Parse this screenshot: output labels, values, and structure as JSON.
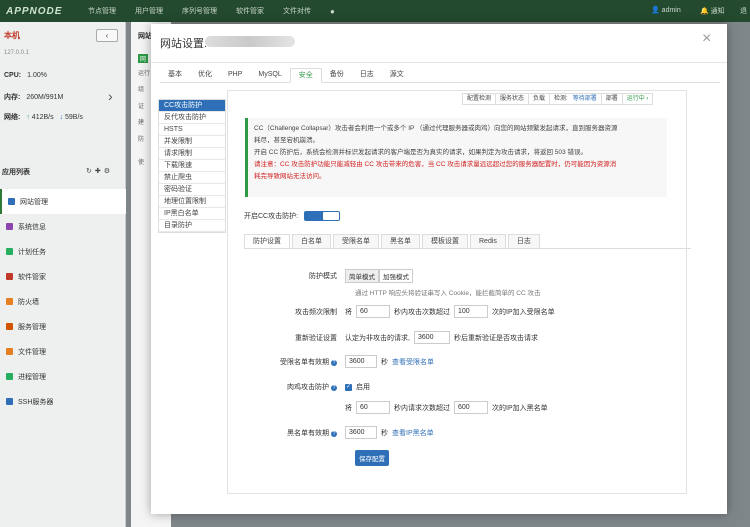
{
  "topnav": {
    "logo": "APPNODE",
    "items": [
      "节点管理",
      "用户管理",
      "序列号管理",
      "软件管家",
      "文件对传"
    ],
    "admin": "admin",
    "notify": "通知",
    "exit": "退"
  },
  "sidebar": {
    "host": "本机",
    "back": "‹",
    "ip": "127.0.0.1",
    "cpu_label": "CPU:",
    "cpu_value": "1.00%",
    "mem_label": "内存:",
    "mem_value": "260M/991M",
    "net_label": "网络:",
    "net_up": "412B/s",
    "net_down": "59B/s",
    "list_header": "应用列表",
    "items": [
      {
        "label": "网站管理",
        "color": "#2e6fb7"
      },
      {
        "label": "系统信息",
        "color": "#8e44ad"
      },
      {
        "label": "计划任务",
        "color": "#27ae60"
      },
      {
        "label": "软件管家",
        "color": "#c0392b"
      },
      {
        "label": "防火墙",
        "color": "#e67e22"
      },
      {
        "label": "服务管理",
        "color": "#d35400"
      },
      {
        "label": "文件管理",
        "color": "#e67e22"
      },
      {
        "label": "进程管理",
        "color": "#27ae60"
      },
      {
        "label": "SSH服务器",
        "color": "#2e6fb7"
      }
    ]
  },
  "bg_fragments": [
    "网站",
    "网",
    "运行",
    "组",
    "证",
    "建",
    "防",
    "使"
  ],
  "modal": {
    "title": "网站设置:",
    "close": "×",
    "tabs": [
      "基本",
      "优化",
      "PHP",
      "MySQL",
      "安全",
      "备份",
      "日志",
      "源文"
    ],
    "active_tab": "安全"
  },
  "status_bar": [
    "配置检测",
    "服务状态",
    "负载",
    "检测:",
    "等待部署",
    "部署",
    "运行中 ›"
  ],
  "left_menu": [
    "CC攻击防护",
    "反代攻击防护",
    "HSTS",
    "并发限制",
    "请求限制",
    "下载限速",
    "禁止爬虫",
    "密码验证",
    "地理位置限制",
    "IP黑白名单",
    "目录防护"
  ],
  "notice": {
    "line1": "CC（Challenge Collapsar）攻击者会利用一个或多个 IP （通过代理服务器或肉鸡）向您的网站频繁发起请求，直到服务器资源",
    "line2": "耗尽，甚至宕机崩溃。",
    "line3": "开启 CC 防护后，系统会检测并标识发起请求的客户端是否为真实的请求，如果判定为攻击请求，将返回 503 错误。",
    "warn1": "请注意：CC 攻击防护功能只能减轻由 CC 攻击带来的危害，当 CC 攻击请求量远远超过您的服务器配置时，仍可能因为资源消",
    "warn2": "耗完导致网站无法访问。"
  },
  "enable_label": "开启CC攻击防护:",
  "sub_tabs": [
    "防护设置",
    "白名单",
    "受限名单",
    "黑名单",
    "模板设置",
    "Redis",
    "日志"
  ],
  "form": {
    "mode_label": "防护模式",
    "mode_simple": "简单模式",
    "mode_enhanced": "加强模式",
    "mode_hint": "通过 HTTP 响应头将验证串写入 Cookie，能拦截简单的 CC 攻击",
    "freq_label": "攻击频次限制",
    "freq_prefix": "将",
    "freq_seconds": "60",
    "freq_mid": "秒内攻击次数超过",
    "freq_count": "100",
    "freq_suffix": "次的IP加入受限名单",
    "reverify_label": "重新验证设置",
    "reverify_prefix": "认定为非攻击的请求,",
    "reverify_seconds": "3600",
    "reverify_suffix": "秒后重新验证是否攻击请求",
    "limit_label": "受限名单有效期",
    "limit_seconds": "3600",
    "limit_unit": "秒",
    "limit_link": "查看受限名单",
    "broiler_label": "肉鸡攻击防护",
    "broiler_enable": "启用",
    "broiler_prefix": "将",
    "broiler_seconds": "60",
    "broiler_mid": "秒内请求次数超过",
    "broiler_count": "600",
    "broiler_suffix": "次的IP加入黑名单",
    "black_label": "黑名单有效期",
    "black_seconds": "3600",
    "black_unit": "秒",
    "black_link": "查看IP黑名单",
    "save": "保存配置"
  }
}
